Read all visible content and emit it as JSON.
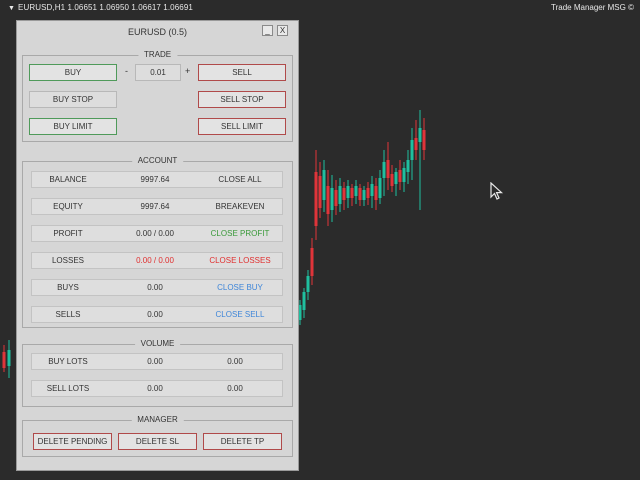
{
  "chart": {
    "symbol_line": "EURUSD,H1  1.06651  1.06950  1.06617  1.06691",
    "badge": "Trade Manager MSG",
    "badge_icon": "copyright-icon"
  },
  "panel": {
    "title": "EURUSD (0.5)",
    "minimize_label": "_",
    "close_label": "X",
    "trade": {
      "label": "TRADE",
      "buy": "BUY",
      "sell": "SELL",
      "minus": "-",
      "plus": "+",
      "lot_value": "0.01",
      "buy_stop": "BUY STOP",
      "sell_stop": "SELL STOP",
      "buy_limit": "BUY LIMIT",
      "sell_limit": "SELL LIMIT"
    },
    "account": {
      "label": "ACCOUNT",
      "rows": [
        {
          "label": "BALANCE",
          "value": "9997.64",
          "action": "CLOSE ALL",
          "value_color": "#333333",
          "action_color": "#333333"
        },
        {
          "label": "EQUITY",
          "value": "9997.64",
          "action": "BREAKEVEN",
          "value_color": "#333333",
          "action_color": "#333333"
        },
        {
          "label": "PROFIT",
          "value": "0.00 / 0.00",
          "action": "CLOSE PROFIT",
          "value_color": "#333333",
          "action_color": "#3a9a3a"
        },
        {
          "label": "LOSSES",
          "value": "0.00 / 0.00",
          "action": "CLOSE LOSSES",
          "value_color": "#e03030",
          "action_color": "#e03030"
        },
        {
          "label": "BUYS",
          "value": "0.00",
          "action": "CLOSE BUY",
          "value_color": "#333333",
          "action_color": "#3f86d8"
        },
        {
          "label": "SELLS",
          "value": "0.00",
          "action": "CLOSE SELL",
          "value_color": "#333333",
          "action_color": "#3f86d8"
        }
      ]
    },
    "volume": {
      "label": "VOLUME",
      "rows": [
        {
          "label": "BUY LOTS",
          "value1": "0.00",
          "value2": "0.00"
        },
        {
          "label": "SELL LOTS",
          "value1": "0.00",
          "value2": "0.00"
        }
      ]
    },
    "manager": {
      "label": "MANAGER",
      "delete_pending": "DELETE PENDING",
      "delete_sl": "DELETE SL",
      "delete_tp": "DELETE TP"
    }
  },
  "colors": {
    "chart_bg": "#2b2b2b",
    "bull": "#1fbf9f",
    "bear": "#e0343a",
    "panel_bg": "#d6d6d6"
  }
}
